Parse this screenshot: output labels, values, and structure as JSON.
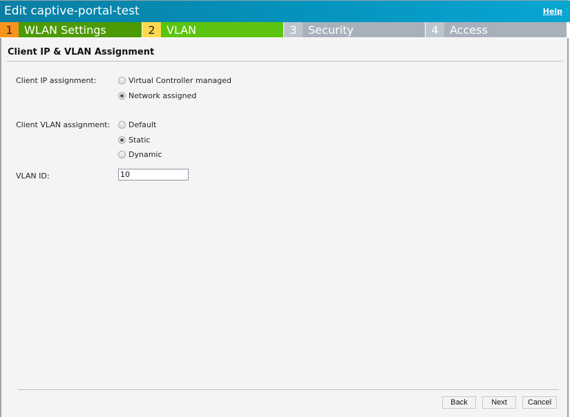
{
  "window": {
    "title": "Edit captive-portal-test",
    "help_label": "Help"
  },
  "steps": [
    {
      "num": "1",
      "label": "WLAN Settings",
      "state": "completed"
    },
    {
      "num": "2",
      "label": "VLAN",
      "state": "active"
    },
    {
      "num": "3",
      "label": "Security",
      "state": "pending"
    },
    {
      "num": "4",
      "label": "Access",
      "state": "pending"
    }
  ],
  "section": {
    "title": "Client IP & VLAN Assignment"
  },
  "client_ip": {
    "label": "Client IP assignment:",
    "options": [
      {
        "label": "Virtual Controller managed",
        "checked": false
      },
      {
        "label": "Network assigned",
        "checked": true
      }
    ]
  },
  "client_vlan": {
    "label": "Client VLAN assignment:",
    "options": [
      {
        "label": "Default",
        "checked": false
      },
      {
        "label": "Static",
        "checked": true
      },
      {
        "label": "Dynamic",
        "checked": false
      }
    ]
  },
  "vlan_id": {
    "label": "VLAN ID:",
    "value": "10"
  },
  "buttons": {
    "back": "Back",
    "next": "Next",
    "cancel": "Cancel"
  }
}
